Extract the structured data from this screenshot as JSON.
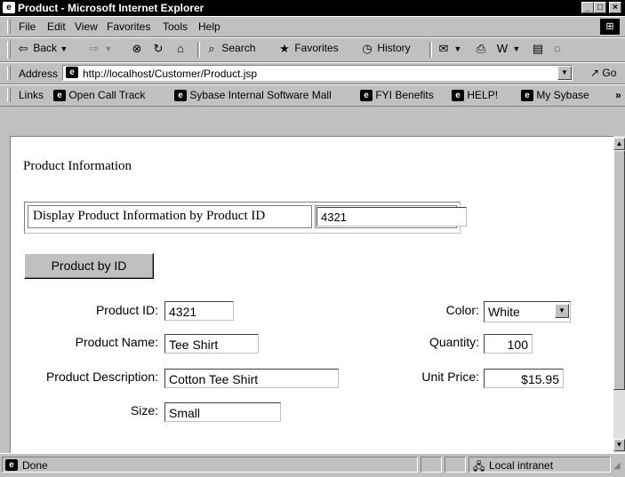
{
  "window": {
    "title": "Product - Microsoft Internet Explorer",
    "buttons": [
      "_",
      "□",
      "×"
    ]
  },
  "menu": [
    "File",
    "Edit",
    "View",
    "Favorites",
    "Tools",
    "Help"
  ],
  "toolbar": {
    "back": "Back",
    "search": "Search",
    "favorites": "Favorites",
    "history": "History"
  },
  "address": {
    "label": "Address",
    "url": "http://localhost/Customer/Product.jsp",
    "go": "Go"
  },
  "links": {
    "label": "Links",
    "items": [
      "Open Call Track",
      "Sybase Internal Software Mall",
      "FYI Benefits",
      "HELP!",
      "My Sybase"
    ]
  },
  "page": {
    "heading": "Product Information",
    "lookup_label": "Display Product Information by Product ID",
    "lookup_value": "4321",
    "submit_button": "Product by ID",
    "fields": {
      "product_id_label": "Product ID:",
      "product_id": "4321",
      "product_name_label": "Product Name:",
      "product_name": "Tee Shirt",
      "product_description_label": "Product Description:",
      "product_description": "Cotton Tee Shirt",
      "size_label": "Size:",
      "size": "Small",
      "color_label": "Color:",
      "color": "White",
      "quantity_label": "Quantity:",
      "quantity": "100",
      "unit_price_label": "Unit Price:",
      "unit_price": "$15.95"
    }
  },
  "status": {
    "text": "Done",
    "zone": "Local intranet"
  }
}
